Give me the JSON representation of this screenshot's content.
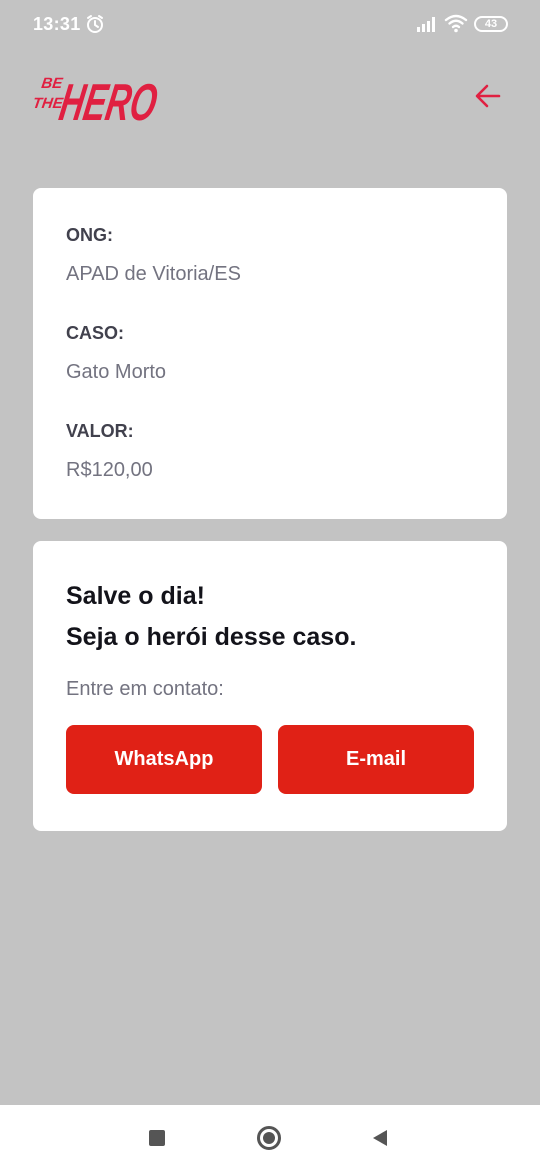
{
  "status_bar": {
    "time": "13:31",
    "battery": "43",
    "icons": [
      "alarm-icon",
      "signal-icon",
      "wifi-icon",
      "battery-icon"
    ]
  },
  "header": {
    "logo": {
      "line1": "BE",
      "line2": "THE",
      "word": "HERO"
    },
    "back_icon": "arrow-left-icon",
    "accent_color": "#e02041"
  },
  "incident": {
    "ong_label": "ONG:",
    "ong_value": "APAD de Vitoria/ES",
    "case_label": "CASO:",
    "case_value": "Gato Morto",
    "value_label": "VALOR:",
    "value_value": "R$120,00"
  },
  "contact": {
    "title_line1": "Salve o dia!",
    "title_line2": "Seja o herói desse caso.",
    "prompt": "Entre em contato:",
    "whatsapp_label": "WhatsApp",
    "email_label": "E-mail",
    "button_color": "#e02116"
  },
  "nav_bar": {
    "icons": [
      "recent-apps-icon",
      "home-icon",
      "back-triangle-icon"
    ]
  }
}
